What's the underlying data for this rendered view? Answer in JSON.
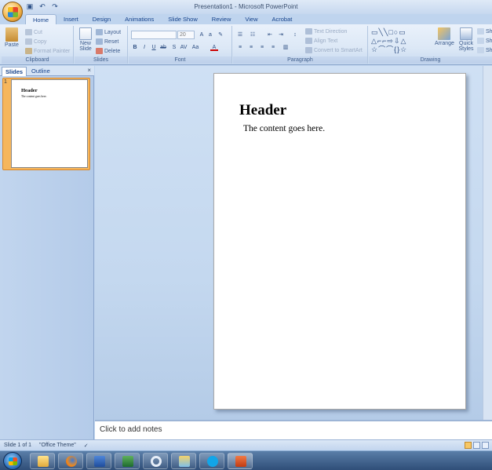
{
  "window": {
    "title": "Presentation1 - Microsoft PowerPoint"
  },
  "tabs": [
    "Home",
    "Insert",
    "Design",
    "Animations",
    "Slide Show",
    "Review",
    "View",
    "Acrobat"
  ],
  "ribbon": {
    "clipboard": {
      "label": "Clipboard",
      "paste": "Paste",
      "cut": "Cut",
      "copy": "Copy",
      "format_painter": "Format Painter"
    },
    "slides": {
      "label": "Slides",
      "new_slide": "New Slide",
      "layout": "Layout",
      "reset": "Reset",
      "delete": "Delete"
    },
    "font": {
      "label": "Font",
      "font_size": "20"
    },
    "paragraph": {
      "label": "Paragraph",
      "text_direction": "Text Direction",
      "align_text": "Align Text",
      "convert_smartart": "Convert to SmartArt"
    },
    "drawing": {
      "label": "Drawing",
      "arrange": "Arrange",
      "quick_styles": "Quick Styles",
      "shape_fill": "Sh",
      "shape_outline": "Sh",
      "shape_effects": "Sh"
    }
  },
  "panel": {
    "tabs": [
      "Slides",
      "Outline"
    ],
    "close": "×",
    "slide_number": "1"
  },
  "slide": {
    "title": "Header",
    "body": "The content goes here."
  },
  "notes": {
    "placeholder": "Click to add notes"
  },
  "status": {
    "slide_info": "Slide 1 of 1",
    "theme": "\"Office Theme\""
  },
  "colors": {
    "ribbon": "#dce8f6",
    "selection": "#f6b65c",
    "taskbar": "#2f4e78"
  }
}
